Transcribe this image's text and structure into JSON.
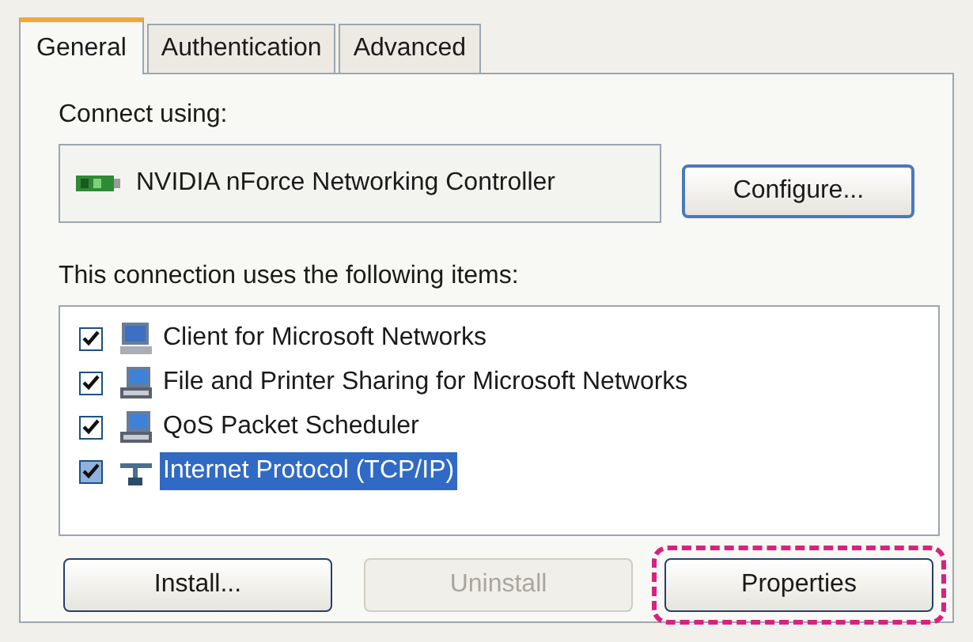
{
  "tabs": [
    {
      "label": "General",
      "selected": true
    },
    {
      "label": "Authentication",
      "selected": false
    },
    {
      "label": "Advanced",
      "selected": false
    }
  ],
  "connect_using": {
    "label": "Connect using:",
    "adapter": "NVIDIA nForce Networking Controller",
    "configure_button": "Configure..."
  },
  "items_label": "This connection uses the following items:",
  "items": [
    {
      "kind": "client",
      "label": "Client for Microsoft Networks",
      "checked": true,
      "selected": false
    },
    {
      "kind": "service",
      "label": "File and Printer Sharing for Microsoft Networks",
      "checked": true,
      "selected": false
    },
    {
      "kind": "service",
      "label": "QoS Packet Scheduler",
      "checked": true,
      "selected": false
    },
    {
      "kind": "protocol",
      "label": "Internet Protocol (TCP/IP)",
      "checked": true,
      "selected": true
    }
  ],
  "buttons": [
    {
      "label": "Install...",
      "disabled": false,
      "highlighted": false
    },
    {
      "label": "Uninstall",
      "disabled": true,
      "highlighted": false
    },
    {
      "label": "Properties",
      "disabled": false,
      "highlighted": true
    }
  ]
}
